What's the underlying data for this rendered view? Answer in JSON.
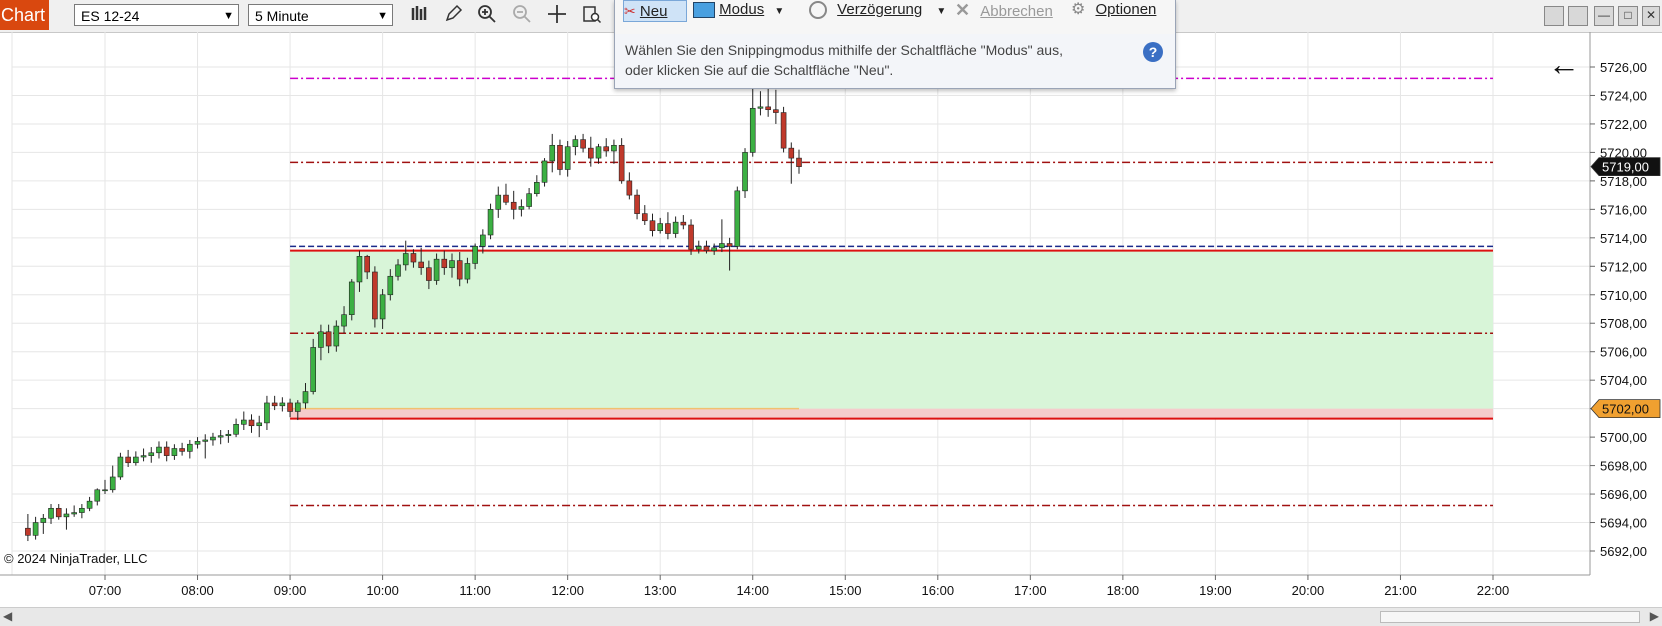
{
  "toolbar": {
    "chart_label": "Chart",
    "instrument": "ES 12-24",
    "interval": "5 Minute"
  },
  "snipping_tool": {
    "buttons": [
      "Neu",
      "Modus",
      "Verzögerung",
      "Abbrechen",
      "Optionen"
    ],
    "hint_line1": "Wählen Sie den Snippingmodus mithilfe der Schaltfläche \"Modus\" aus,",
    "hint_line2": "oder klicken Sie auf die Schaltfläche \"Neu\".",
    "help": "?"
  },
  "copyright": "© 2024 NinjaTrader, LLC",
  "colors": {
    "up": "#3cb043",
    "down": "#c0392b",
    "zone": "#d8f5d8",
    "price_flag": "#111111",
    "entry_flag": "#f0a030"
  },
  "chart_data": {
    "type": "candlestick",
    "instrument": "ES 12-24",
    "y_ticks": [
      "5726,00",
      "5724,00",
      "5722,00",
      "5720,00",
      "5718,00",
      "5716,00",
      "5714,00",
      "5712,00",
      "5710,00",
      "5708,00",
      "5706,00",
      "5704,00",
      "5702,00",
      "5700,00",
      "5698,00",
      "5696,00",
      "5694,00",
      "5692,00"
    ],
    "y_range": [
      5690.5,
      5728.5
    ],
    "x_ticks": [
      "07:00",
      "08:00",
      "09:00",
      "10:00",
      "11:00",
      "12:00",
      "13:00",
      "14:00",
      "15:00",
      "16:00",
      "17:00",
      "18:00",
      "19:00",
      "20:00",
      "21:00",
      "22:00"
    ],
    "x_range_hours": [
      6.0,
      23.0
    ],
    "current_price_label": "5719,00",
    "current_price": 5719.0,
    "entry_price_label": "5702,00",
    "entry_price": 5702.0,
    "levels": [
      {
        "price": 5725.2,
        "style": "dashdot",
        "color": "#cc00cc"
      },
      {
        "price": 5719.3,
        "style": "dashdot",
        "color": "#a01010"
      },
      {
        "price": 5713.4,
        "style": "dashed",
        "color": "#1a2a8a"
      },
      {
        "price": 5713.1,
        "style": "solid",
        "color": "#dd1111"
      },
      {
        "price": 5707.3,
        "style": "dashdot",
        "color": "#a01010"
      },
      {
        "price": 5701.3,
        "style": "solid",
        "color": "#dd1111"
      },
      {
        "price": 5695.2,
        "style": "dashdot",
        "color": "#a01010"
      }
    ],
    "zone": {
      "from": 5701.3,
      "to": 5713.1,
      "start": "09:00",
      "end": "22:00"
    },
    "red_zone": {
      "from": 5701.3,
      "to": 5702.0
    },
    "candles": [
      {
        "t": "06:10",
        "o": 5693.6,
        "h": 5694.6,
        "l": 5692.7,
        "c": 5693.1
      },
      {
        "t": "06:15",
        "o": 5693.1,
        "h": 5694.4,
        "l": 5692.8,
        "c": 5694.0
      },
      {
        "t": "06:20",
        "o": 5694.0,
        "h": 5694.6,
        "l": 5693.2,
        "c": 5694.3
      },
      {
        "t": "06:25",
        "o": 5694.3,
        "h": 5695.3,
        "l": 5693.9,
        "c": 5695.0
      },
      {
        "t": "06:30",
        "o": 5695.0,
        "h": 5695.3,
        "l": 5694.2,
        "c": 5694.4
      },
      {
        "t": "06:35",
        "o": 5694.4,
        "h": 5695.0,
        "l": 5693.5,
        "c": 5694.6
      },
      {
        "t": "06:40",
        "o": 5694.6,
        "h": 5695.2,
        "l": 5694.4,
        "c": 5694.7
      },
      {
        "t": "06:45",
        "o": 5694.7,
        "h": 5695.3,
        "l": 5694.3,
        "c": 5695.0
      },
      {
        "t": "06:50",
        "o": 5695.0,
        "h": 5695.8,
        "l": 5694.8,
        "c": 5695.5
      },
      {
        "t": "06:55",
        "o": 5695.5,
        "h": 5696.4,
        "l": 5695.2,
        "c": 5696.3
      },
      {
        "t": "07:00",
        "o": 5696.3,
        "h": 5697.0,
        "l": 5696.0,
        "c": 5696.3
      },
      {
        "t": "07:05",
        "o": 5696.3,
        "h": 5698.0,
        "l": 5696.1,
        "c": 5697.2
      },
      {
        "t": "07:10",
        "o": 5697.2,
        "h": 5698.9,
        "l": 5697.0,
        "c": 5698.6
      },
      {
        "t": "07:15",
        "o": 5698.6,
        "h": 5699.1,
        "l": 5697.9,
        "c": 5698.2
      },
      {
        "t": "07:20",
        "o": 5698.2,
        "h": 5699.0,
        "l": 5698.0,
        "c": 5698.6
      },
      {
        "t": "07:25",
        "o": 5698.6,
        "h": 5699.2,
        "l": 5698.3,
        "c": 5698.7
      },
      {
        "t": "07:30",
        "o": 5698.7,
        "h": 5699.3,
        "l": 5698.2,
        "c": 5698.9
      },
      {
        "t": "07:35",
        "o": 5698.9,
        "h": 5699.7,
        "l": 5698.5,
        "c": 5699.3
      },
      {
        "t": "07:40",
        "o": 5699.3,
        "h": 5699.7,
        "l": 5698.3,
        "c": 5698.7
      },
      {
        "t": "07:45",
        "o": 5698.7,
        "h": 5699.5,
        "l": 5698.4,
        "c": 5699.2
      },
      {
        "t": "07:50",
        "o": 5699.2,
        "h": 5699.6,
        "l": 5698.7,
        "c": 5699.0
      },
      {
        "t": "07:55",
        "o": 5699.0,
        "h": 5699.8,
        "l": 5698.5,
        "c": 5699.5
      },
      {
        "t": "08:00",
        "o": 5699.5,
        "h": 5700.0,
        "l": 5699.2,
        "c": 5699.7
      },
      {
        "t": "08:05",
        "o": 5699.7,
        "h": 5700.2,
        "l": 5698.5,
        "c": 5699.8
      },
      {
        "t": "08:10",
        "o": 5699.8,
        "h": 5700.3,
        "l": 5699.4,
        "c": 5700.0
      },
      {
        "t": "08:15",
        "o": 5700.0,
        "h": 5700.5,
        "l": 5699.5,
        "c": 5700.1
      },
      {
        "t": "08:20",
        "o": 5700.1,
        "h": 5700.5,
        "l": 5699.6,
        "c": 5700.2
      },
      {
        "t": "08:25",
        "o": 5700.2,
        "h": 5701.3,
        "l": 5700.0,
        "c": 5700.9
      },
      {
        "t": "08:30",
        "o": 5700.9,
        "h": 5701.8,
        "l": 5700.5,
        "c": 5701.2
      },
      {
        "t": "08:35",
        "o": 5701.2,
        "h": 5701.6,
        "l": 5700.3,
        "c": 5700.8
      },
      {
        "t": "08:40",
        "o": 5700.8,
        "h": 5701.5,
        "l": 5700.0,
        "c": 5701.0
      },
      {
        "t": "08:45",
        "o": 5701.0,
        "h": 5702.9,
        "l": 5700.5,
        "c": 5702.4
      },
      {
        "t": "08:50",
        "o": 5702.4,
        "h": 5702.9,
        "l": 5701.9,
        "c": 5702.2
      },
      {
        "t": "08:55",
        "o": 5702.2,
        "h": 5702.8,
        "l": 5701.8,
        "c": 5702.4
      },
      {
        "t": "09:00",
        "o": 5702.4,
        "h": 5702.7,
        "l": 5701.4,
        "c": 5701.8
      },
      {
        "t": "09:05",
        "o": 5701.8,
        "h": 5702.6,
        "l": 5701.2,
        "c": 5702.4
      },
      {
        "t": "09:10",
        "o": 5702.4,
        "h": 5703.8,
        "l": 5702.0,
        "c": 5703.2
      },
      {
        "t": "09:15",
        "o": 5703.2,
        "h": 5706.9,
        "l": 5703.0,
        "c": 5706.3
      },
      {
        "t": "09:20",
        "o": 5706.3,
        "h": 5707.9,
        "l": 5705.4,
        "c": 5707.4
      },
      {
        "t": "09:25",
        "o": 5707.4,
        "h": 5707.9,
        "l": 5705.9,
        "c": 5706.4
      },
      {
        "t": "09:30",
        "o": 5706.4,
        "h": 5708.2,
        "l": 5706.0,
        "c": 5707.8
      },
      {
        "t": "09:35",
        "o": 5707.8,
        "h": 5709.2,
        "l": 5707.3,
        "c": 5708.6
      },
      {
        "t": "09:40",
        "o": 5708.6,
        "h": 5711.1,
        "l": 5708.2,
        "c": 5710.9
      },
      {
        "t": "09:45",
        "o": 5710.9,
        "h": 5713.1,
        "l": 5710.2,
        "c": 5712.7
      },
      {
        "t": "09:50",
        "o": 5712.7,
        "h": 5712.8,
        "l": 5711.1,
        "c": 5711.6
      },
      {
        "t": "09:55",
        "o": 5711.6,
        "h": 5712.0,
        "l": 5707.7,
        "c": 5708.3
      },
      {
        "t": "10:00",
        "o": 5708.3,
        "h": 5710.4,
        "l": 5707.6,
        "c": 5710.0
      },
      {
        "t": "10:05",
        "o": 5710.0,
        "h": 5711.8,
        "l": 5709.6,
        "c": 5711.3
      },
      {
        "t": "10:10",
        "o": 5711.3,
        "h": 5712.5,
        "l": 5711.0,
        "c": 5712.1
      },
      {
        "t": "10:15",
        "o": 5712.1,
        "h": 5713.8,
        "l": 5711.7,
        "c": 5712.9
      },
      {
        "t": "10:20",
        "o": 5712.9,
        "h": 5713.2,
        "l": 5711.9,
        "c": 5712.3
      },
      {
        "t": "10:25",
        "o": 5712.3,
        "h": 5713.3,
        "l": 5711.4,
        "c": 5711.9
      },
      {
        "t": "10:30",
        "o": 5711.9,
        "h": 5712.4,
        "l": 5710.4,
        "c": 5711.0
      },
      {
        "t": "10:35",
        "o": 5711.0,
        "h": 5712.9,
        "l": 5710.7,
        "c": 5712.5
      },
      {
        "t": "10:40",
        "o": 5712.5,
        "h": 5713.1,
        "l": 5711.4,
        "c": 5711.9
      },
      {
        "t": "10:45",
        "o": 5711.9,
        "h": 5712.9,
        "l": 5711.2,
        "c": 5712.4
      },
      {
        "t": "10:50",
        "o": 5712.4,
        "h": 5713.0,
        "l": 5710.6,
        "c": 5711.1
      },
      {
        "t": "10:55",
        "o": 5711.1,
        "h": 5712.6,
        "l": 5710.8,
        "c": 5712.2
      },
      {
        "t": "11:00",
        "o": 5712.2,
        "h": 5713.6,
        "l": 5711.8,
        "c": 5713.4
      },
      {
        "t": "11:05",
        "o": 5713.4,
        "h": 5714.6,
        "l": 5712.9,
        "c": 5714.2
      },
      {
        "t": "11:10",
        "o": 5714.2,
        "h": 5716.4,
        "l": 5713.9,
        "c": 5716.0
      },
      {
        "t": "11:15",
        "o": 5716.0,
        "h": 5717.6,
        "l": 5715.4,
        "c": 5717.0
      },
      {
        "t": "11:20",
        "o": 5717.0,
        "h": 5717.8,
        "l": 5716.3,
        "c": 5716.5
      },
      {
        "t": "11:25",
        "o": 5716.5,
        "h": 5717.3,
        "l": 5715.3,
        "c": 5716.0
      },
      {
        "t": "11:30",
        "o": 5716.0,
        "h": 5716.7,
        "l": 5715.5,
        "c": 5716.2
      },
      {
        "t": "11:35",
        "o": 5716.2,
        "h": 5717.5,
        "l": 5716.0,
        "c": 5717.1
      },
      {
        "t": "11:40",
        "o": 5717.1,
        "h": 5718.4,
        "l": 5716.9,
        "c": 5717.9
      },
      {
        "t": "11:45",
        "o": 5717.9,
        "h": 5719.6,
        "l": 5717.6,
        "c": 5719.4
      },
      {
        "t": "11:50",
        "o": 5719.4,
        "h": 5721.3,
        "l": 5718.6,
        "c": 5720.5
      },
      {
        "t": "11:55",
        "o": 5720.5,
        "h": 5720.9,
        "l": 5718.4,
        "c": 5718.8
      },
      {
        "t": "12:00",
        "o": 5718.8,
        "h": 5720.8,
        "l": 5718.3,
        "c": 5720.4
      },
      {
        "t": "12:05",
        "o": 5720.4,
        "h": 5721.2,
        "l": 5719.8,
        "c": 5720.9
      },
      {
        "t": "12:10",
        "o": 5720.9,
        "h": 5721.3,
        "l": 5720.0,
        "c": 5720.3
      },
      {
        "t": "12:15",
        "o": 5720.3,
        "h": 5721.1,
        "l": 5719.0,
        "c": 5719.6
      },
      {
        "t": "12:20",
        "o": 5719.6,
        "h": 5720.6,
        "l": 5719.2,
        "c": 5720.4
      },
      {
        "t": "12:25",
        "o": 5720.4,
        "h": 5721.0,
        "l": 5719.7,
        "c": 5720.1
      },
      {
        "t": "12:30",
        "o": 5720.1,
        "h": 5720.9,
        "l": 5719.2,
        "c": 5720.5
      },
      {
        "t": "12:35",
        "o": 5720.5,
        "h": 5721.0,
        "l": 5717.8,
        "c": 5718.0
      },
      {
        "t": "12:40",
        "o": 5718.0,
        "h": 5718.6,
        "l": 5716.7,
        "c": 5717.0
      },
      {
        "t": "12:45",
        "o": 5717.0,
        "h": 5717.4,
        "l": 5715.3,
        "c": 5715.7
      },
      {
        "t": "12:50",
        "o": 5715.7,
        "h": 5716.3,
        "l": 5714.9,
        "c": 5715.2
      },
      {
        "t": "12:55",
        "o": 5715.2,
        "h": 5715.7,
        "l": 5714.1,
        "c": 5714.5
      },
      {
        "t": "13:00",
        "o": 5714.5,
        "h": 5715.4,
        "l": 5714.3,
        "c": 5715.0
      },
      {
        "t": "13:05",
        "o": 5715.0,
        "h": 5715.8,
        "l": 5713.9,
        "c": 5714.3
      },
      {
        "t": "13:10",
        "o": 5714.3,
        "h": 5715.5,
        "l": 5714.0,
        "c": 5715.1
      },
      {
        "t": "13:15",
        "o": 5715.1,
        "h": 5715.6,
        "l": 5714.6,
        "c": 5714.9
      },
      {
        "t": "13:20",
        "o": 5714.9,
        "h": 5715.3,
        "l": 5712.8,
        "c": 5713.2
      },
      {
        "t": "13:25",
        "o": 5713.2,
        "h": 5713.8,
        "l": 5712.9,
        "c": 5713.4
      },
      {
        "t": "13:30",
        "o": 5713.4,
        "h": 5713.8,
        "l": 5712.9,
        "c": 5713.1
      },
      {
        "t": "13:35",
        "o": 5713.1,
        "h": 5713.6,
        "l": 5712.8,
        "c": 5713.3
      },
      {
        "t": "13:40",
        "o": 5713.3,
        "h": 5715.3,
        "l": 5713.0,
        "c": 5713.6
      },
      {
        "t": "13:45",
        "o": 5713.6,
        "h": 5714.0,
        "l": 5711.7,
        "c": 5713.4
      },
      {
        "t": "13:50",
        "o": 5713.4,
        "h": 5717.6,
        "l": 5713.2,
        "c": 5717.3
      },
      {
        "t": "13:55",
        "o": 5717.3,
        "h": 5720.3,
        "l": 5716.8,
        "c": 5720.0
      },
      {
        "t": "14:00",
        "o": 5720.0,
        "h": 5725.3,
        "l": 5719.7,
        "c": 5723.1
      },
      {
        "t": "14:05",
        "o": 5723.1,
        "h": 5724.3,
        "l": 5722.6,
        "c": 5723.2
      },
      {
        "t": "14:10",
        "o": 5723.2,
        "h": 5724.7,
        "l": 5722.5,
        "c": 5723.0
      },
      {
        "t": "14:15",
        "o": 5723.0,
        "h": 5724.4,
        "l": 5722.0,
        "c": 5722.8
      },
      {
        "t": "14:20",
        "o": 5722.8,
        "h": 5723.2,
        "l": 5720.0,
        "c": 5720.3
      },
      {
        "t": "14:25",
        "o": 5720.3,
        "h": 5720.7,
        "l": 5717.8,
        "c": 5719.6
      },
      {
        "t": "14:30",
        "o": 5719.6,
        "h": 5720.2,
        "l": 5718.5,
        "c": 5719.0
      }
    ]
  }
}
